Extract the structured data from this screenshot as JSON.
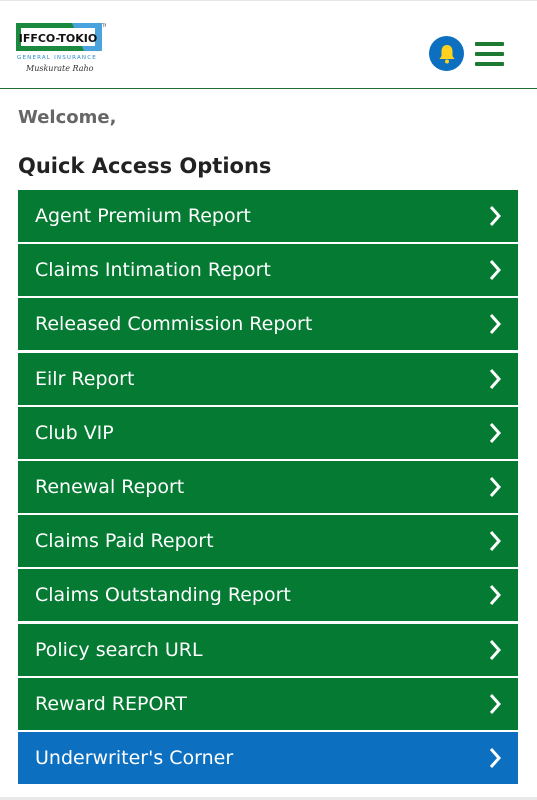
{
  "logo": {
    "brand_text": "IFFCO-TOKIO",
    "subtitle": "GENERAL INSURANCE",
    "tagline": "Muskurate Raho",
    "colors": {
      "green": "#1c8a3e",
      "blue": "#4aa3dd",
      "dark": "#222222"
    }
  },
  "header": {
    "bell_icon": "bell-icon",
    "menu_icon": "hamburger-menu-icon"
  },
  "welcome": "Welcome,",
  "section_title": "Quick Access Options",
  "options": [
    {
      "label": "Agent Premium Report"
    },
    {
      "label": "Claims Intimation Report"
    },
    {
      "label": "Released Commission Report"
    },
    {
      "label": "Eilr Report"
    },
    {
      "label": "Club VIP"
    },
    {
      "label": "Renewal Report"
    },
    {
      "label": "Claims Paid Report"
    },
    {
      "label": "Claims Outstanding Report"
    },
    {
      "label": "Policy search URL"
    },
    {
      "label": "Reward REPORT"
    },
    {
      "label": "Underwriter's Corner"
    }
  ],
  "colors": {
    "option_green": "#047a32",
    "option_blue": "#0c6fc0",
    "header_green": "#1c7a32"
  }
}
